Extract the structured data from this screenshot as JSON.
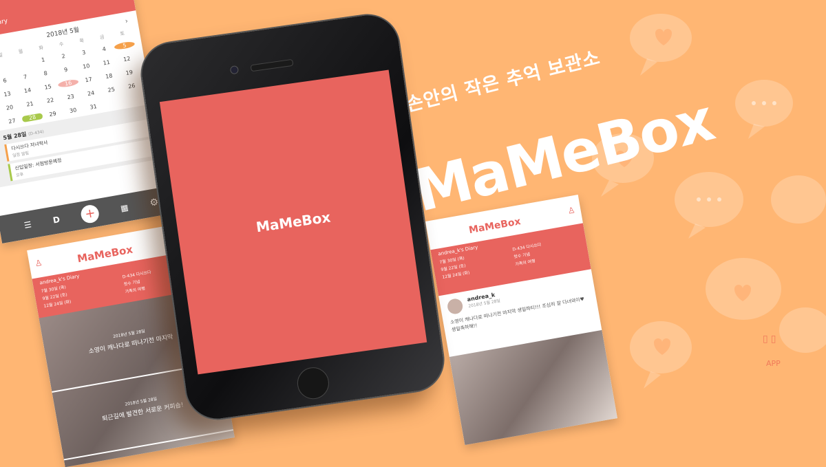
{
  "tagline": "내손안의 작은 추억 보관소",
  "brand": "MaMeBox",
  "phone": {
    "splash_logo": "MaMeBox"
  },
  "calendar": {
    "header_title": "Diary",
    "month_label": "2018년 5월",
    "weekdays": [
      "일",
      "월",
      "화",
      "수",
      "목",
      "금",
      "토"
    ],
    "days": [
      "",
      "",
      "1",
      "2",
      "3",
      "4",
      "5",
      "6",
      "7",
      "8",
      "9",
      "10",
      "11",
      "12",
      "13",
      "14",
      "15",
      "16",
      "17",
      "18",
      "19",
      "20",
      "21",
      "22",
      "23",
      "24",
      "25",
      "26",
      "27",
      "28",
      "29",
      "30",
      "31",
      "",
      ""
    ],
    "selected_day": "28",
    "today_day": "16",
    "first_day": "5",
    "list_header": "5월 28일",
    "list_header_sub": "(D-434)",
    "events": [
      {
        "title": "다시쓰다 자녀학사",
        "sub": "일정 알림",
        "color": "#f5a04a"
      },
      {
        "title": "신입일정: 서점방문예정",
        "sub": "오후",
        "color": "#a8c94b"
      }
    ],
    "nav_d": "D"
  },
  "diary_left": {
    "logo": "MaMeBox",
    "diary_label": "andrea_k's Diary",
    "info_rows": [
      "7월 30일 (목)",
      "9월 22일 (토)",
      "12월 24일 (화)"
    ],
    "info_right": [
      "D-434 다시쓰다",
      "첫수 기념",
      "가족의 여행"
    ],
    "posts": [
      {
        "date": "2018년 5월 28일",
        "caption": "소영이 캐나다로 떠나기전 마지막"
      },
      {
        "date": "2018년 5월 28일",
        "caption": "퇴근길에 발견한 서로운 커피숍!"
      }
    ]
  },
  "diary_right": {
    "logo": "MaMeBox",
    "diary_label": "andrea_k's Diary",
    "info_rows": [
      "7월 30일 (목)",
      "9월 22일 (토)",
      "12월 24일 (화)"
    ],
    "info_right": [
      "D-434 다시쓰다",
      "첫수 기념",
      "가족의 여행"
    ],
    "author": "andrea_k",
    "date": "2018년 5월 28일",
    "body": "소영이 캐나다로 떠나기전 마지막 생일파티!!! 조심히 잘 다녀와이♥ 생일축하해!!"
  },
  "app_label": "APP",
  "colors": {
    "background": "#ffb673",
    "accent": "#e8645e"
  }
}
